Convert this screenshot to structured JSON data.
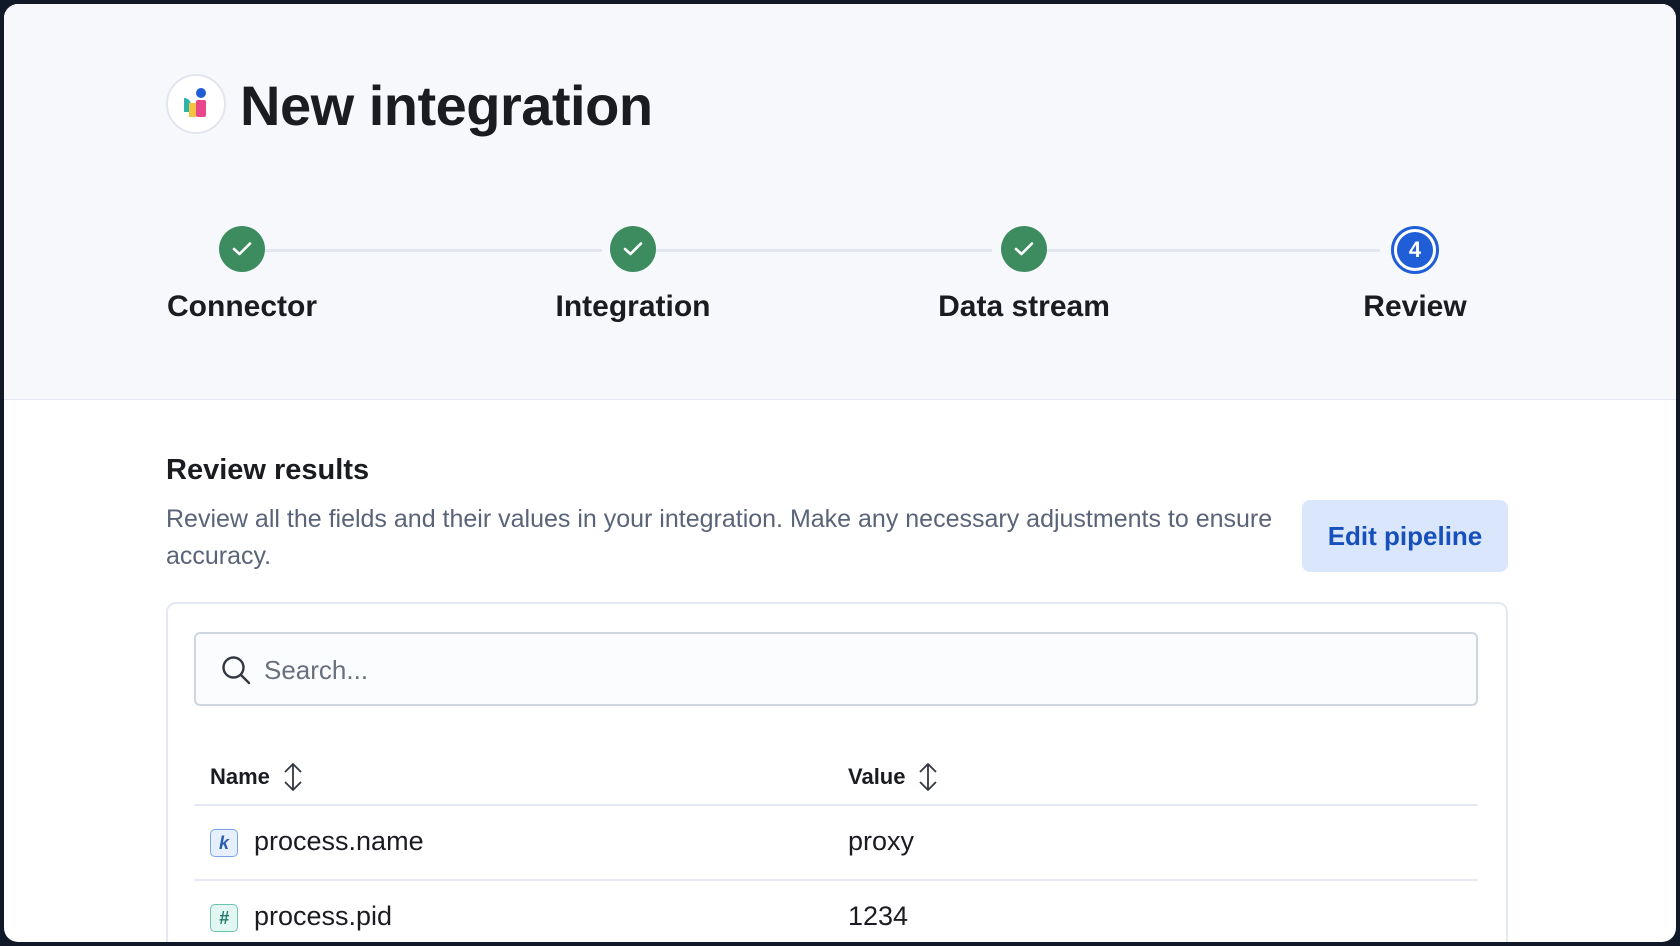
{
  "page": {
    "title": "New integration"
  },
  "steps": [
    {
      "label": "Connector",
      "status": "complete"
    },
    {
      "label": "Integration",
      "status": "complete"
    },
    {
      "label": "Data stream",
      "status": "complete"
    },
    {
      "label": "Review",
      "status": "current",
      "number": "4"
    }
  ],
  "review": {
    "title": "Review results",
    "description": "Review all the fields and their values in your integration. Make any necessary adjustments to ensure accuracy.",
    "edit_button": "Edit pipeline"
  },
  "search": {
    "placeholder": "Search...",
    "value": ""
  },
  "table": {
    "columns": [
      "Name",
      "Value"
    ],
    "rows": [
      {
        "type": "k",
        "type_icon": "keyword-icon",
        "name": "process.name",
        "value": "proxy"
      },
      {
        "type": "#",
        "type_icon": "number-icon",
        "name": "process.pid",
        "value": "1234"
      }
    ]
  },
  "colors": {
    "complete": "#3d8c5f",
    "current": "#1f5ed7",
    "button_bg": "#d9e6fb",
    "button_text": "#1750ba"
  }
}
